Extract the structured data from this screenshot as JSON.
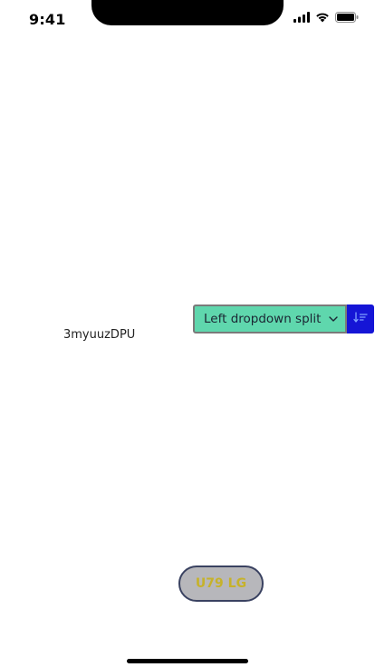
{
  "status_bar": {
    "time": "9:41",
    "icons": [
      "signal-icon",
      "wifi-icon",
      "battery-icon"
    ]
  },
  "floating_label": "3myuuzDPU",
  "split_dropdown": {
    "label": "Left dropdown split",
    "chevron_icon": "chevron-down-icon",
    "sort_icon": "sort-descending-icon",
    "colors": {
      "main_bg": "#5fd7ad",
      "sort_bg": "#1515d6"
    }
  },
  "pill_button": {
    "label": "U79 LG",
    "colors": {
      "bg": "#b7b7bb",
      "text": "#c6b22a",
      "border": "#3a4261"
    }
  }
}
